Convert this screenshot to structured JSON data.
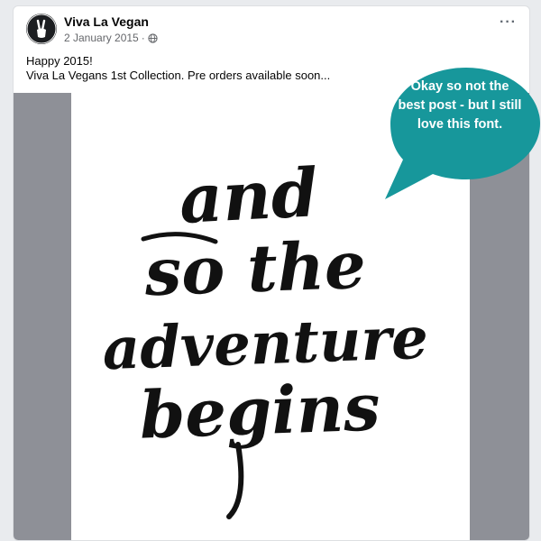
{
  "post": {
    "page_name": "Viva La Vegan",
    "date": "2 January 2015",
    "separator": "·",
    "audience_icon": "globe-icon",
    "more_label": "···",
    "text_lines": [
      "Happy 2015!",
      "Viva La Vegans 1st Collection. Pre orders available soon..."
    ],
    "image": {
      "lines": [
        "and",
        "so the",
        "adventure",
        "begins"
      ]
    }
  },
  "callout": {
    "text": "Okay so not the best post - but I still love this font.",
    "color": "#17979b"
  }
}
